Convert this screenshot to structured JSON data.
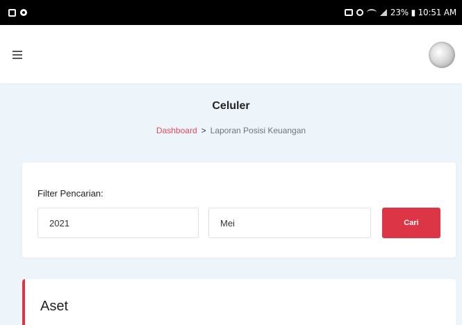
{
  "status_bar": {
    "info": "23% ▮ 10:51 AM"
  },
  "page": {
    "title": "Celuler"
  },
  "breadcrumb": {
    "link": "Dashboard",
    "separator": ">",
    "current": "Laporan Posisi Keuangan"
  },
  "filter": {
    "label": "Filter Pencarian:",
    "year_value": "2021",
    "month_value": "Mei",
    "search_button": "Cari"
  },
  "section": {
    "title": "Aset"
  },
  "colors": {
    "accent": "#dc3545",
    "breadcrumb_link": "#e24a5a",
    "background": "#eef5fa"
  },
  "icons": {
    "menu": "hamburger-menu-icon",
    "avatar": "user-avatar"
  }
}
